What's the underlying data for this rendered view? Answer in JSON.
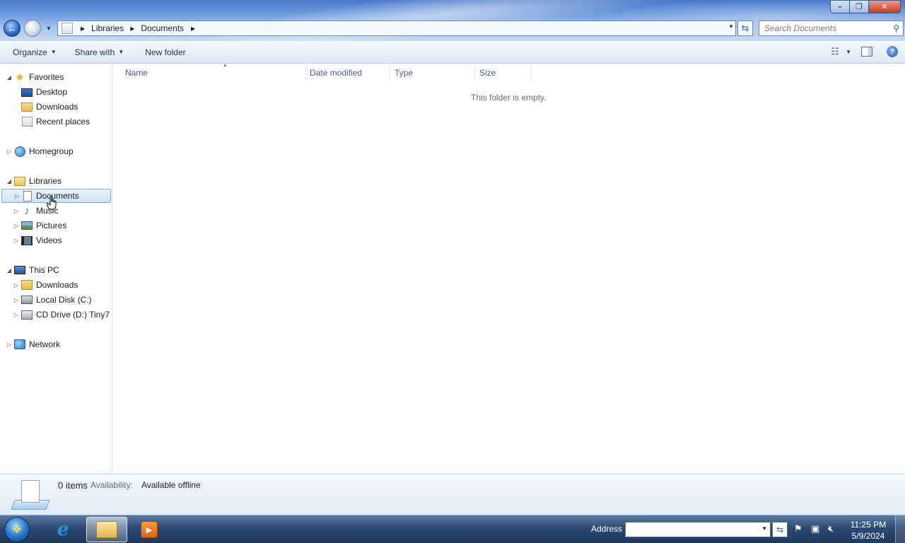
{
  "window": {
    "controls": {
      "minimize": "–",
      "maximize": "❐",
      "close": "✕"
    }
  },
  "address": {
    "crumbs": [
      "Libraries",
      "Documents"
    ],
    "search_placeholder": "Search Documents"
  },
  "commands": {
    "organize": "Organize",
    "share_with": "Share with",
    "new_folder": "New folder"
  },
  "nav": {
    "favorites": "Favorites",
    "desktop": "Desktop",
    "downloads": "Downloads",
    "recent_places": "Recent places",
    "homegroup": "Homegroup",
    "libraries": "Libraries",
    "documents": "Documents",
    "music": "Music",
    "pictures": "Pictures",
    "videos": "Videos",
    "this_pc": "This PC",
    "pc_downloads": "Downloads",
    "local_disk": "Local Disk (C:)",
    "cd_drive": "CD Drive (D:) Tiny7 ›",
    "network": "Network"
  },
  "columns": {
    "name": "Name",
    "date_modified": "Date modified",
    "type": "Type",
    "size": "Size"
  },
  "content": {
    "empty_message": "This folder is empty."
  },
  "details": {
    "count": "0 items",
    "availability_label": "Availability:",
    "availability_value": "Available offline"
  },
  "taskbar": {
    "address_label": "Address",
    "address_value": "",
    "time": "11:25 PM",
    "date": "5/9/2024"
  },
  "colors": {
    "accent": "#2a66c4",
    "selection": "#cfe2fa"
  }
}
